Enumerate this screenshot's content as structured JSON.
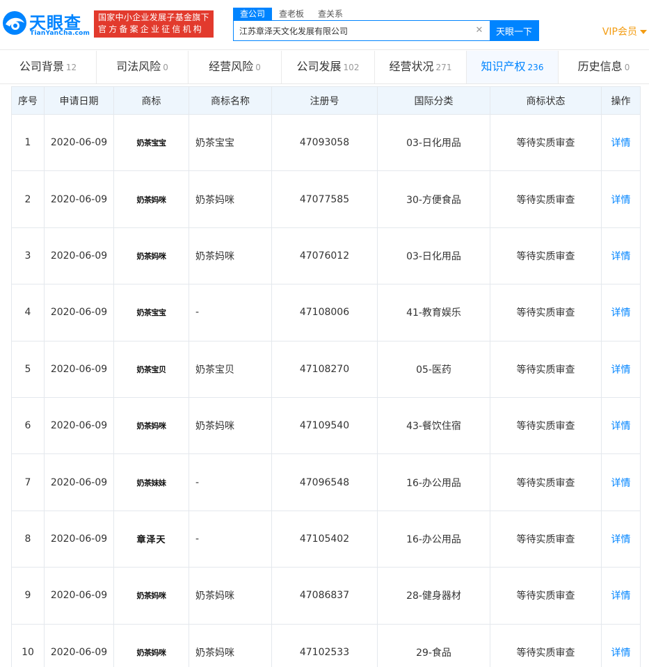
{
  "brand": {
    "name_cn": "天眼查",
    "name_en": "TianYanCha.com",
    "color": "#0084ff",
    "banner_line1": "国家中小企业发展子基金旗下",
    "banner_line2": "官方备案企业征信机构",
    "banner_color": "#e23a2d"
  },
  "search": {
    "tabs": [
      "查公司",
      "查老板",
      "查关系"
    ],
    "active_tab": "查公司",
    "value": "江苏章泽天文化发展有限公司",
    "clear_icon": "close-icon",
    "button_label": "天眼一下"
  },
  "vip": {
    "label": "VIP会员",
    "icon": "caret-down-icon",
    "color": "#f39c12"
  },
  "categories": [
    {
      "label": "公司背景",
      "count": "12"
    },
    {
      "label": "司法风险",
      "count": "0"
    },
    {
      "label": "经营风险",
      "count": "0"
    },
    {
      "label": "公司发展",
      "count": "102"
    },
    {
      "label": "经营状况",
      "count": "271"
    },
    {
      "label": "知识产权",
      "count": "236",
      "active": true
    },
    {
      "label": "历史信息",
      "count": "0"
    }
  ],
  "table": {
    "headers": [
      "序号",
      "申请日期",
      "商标",
      "商标名称",
      "注册号",
      "国际分类",
      "商标状态",
      "操作"
    ],
    "rows": [
      {
        "no": "1",
        "date": "2020-06-09",
        "logo": "奶茶宝宝",
        "name": "奶茶宝宝",
        "reg_no": "47093058",
        "class": "03-日化用品",
        "status": "等待实质审查",
        "action": "详情"
      },
      {
        "no": "2",
        "date": "2020-06-09",
        "logo": "奶茶妈咪",
        "name": "奶茶妈咪",
        "reg_no": "47077585",
        "class": "30-方便食品",
        "status": "等待实质审查",
        "action": "详情"
      },
      {
        "no": "3",
        "date": "2020-06-09",
        "logo": "奶茶妈咪",
        "name": "奶茶妈咪",
        "reg_no": "47076012",
        "class": "03-日化用品",
        "status": "等待实质审查",
        "action": "详情"
      },
      {
        "no": "4",
        "date": "2020-06-09",
        "logo": "奶茶宝宝",
        "name": "-",
        "reg_no": "47108006",
        "class": "41-教育娱乐",
        "status": "等待实质审查",
        "action": "详情"
      },
      {
        "no": "5",
        "date": "2020-06-09",
        "logo": "奶茶宝贝",
        "name": "奶茶宝贝",
        "reg_no": "47108270",
        "class": "05-医药",
        "status": "等待实质审查",
        "action": "详情"
      },
      {
        "no": "6",
        "date": "2020-06-09",
        "logo": "奶茶妈咪",
        "name": "奶茶妈咪",
        "reg_no": "47109540",
        "class": "43-餐饮住宿",
        "status": "等待实质审查",
        "action": "详情"
      },
      {
        "no": "7",
        "date": "2020-06-09",
        "logo": "奶茶妹妹",
        "name": "-",
        "reg_no": "47096548",
        "class": "16-办公用品",
        "status": "等待实质审查",
        "action": "详情"
      },
      {
        "no": "8",
        "date": "2020-06-09",
        "logo": "章泽天",
        "name": "-",
        "reg_no": "47105402",
        "class": "16-办公用品",
        "status": "等待实质审查",
        "action": "详情"
      },
      {
        "no": "9",
        "date": "2020-06-09",
        "logo": "奶茶妈咪",
        "name": "奶茶妈咪",
        "reg_no": "47086837",
        "class": "28-健身器材",
        "status": "等待实质审查",
        "action": "详情"
      },
      {
        "no": "10",
        "date": "2020-06-09",
        "logo": "奶茶妈咪",
        "name": "奶茶妈咪",
        "reg_no": "47102533",
        "class": "29-食品",
        "status": "等待实质审查",
        "action": "详情"
      }
    ]
  }
}
